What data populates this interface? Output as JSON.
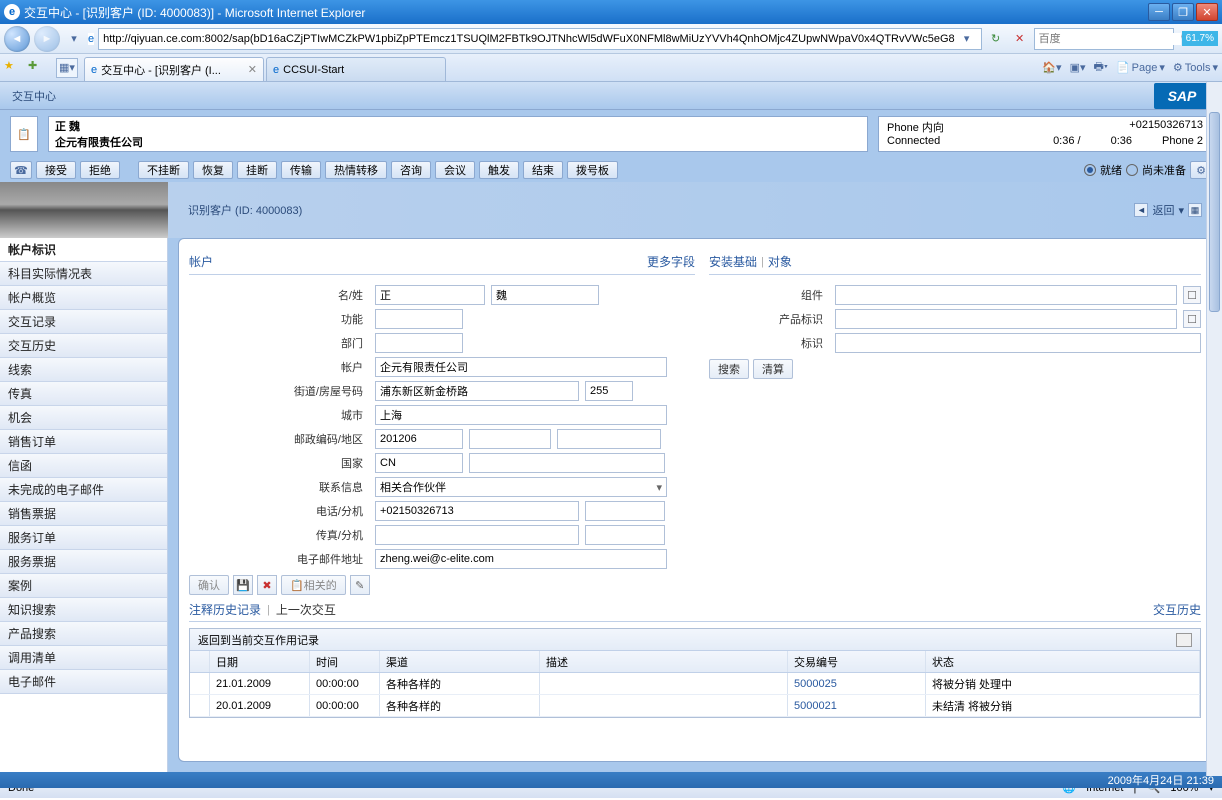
{
  "window": {
    "title": "交互中心 - [识别客户 (ID: 4000083)] - Microsoft Internet Explorer"
  },
  "nav": {
    "url": "http://qiyuan.ce.com:8002/sap(bD16aCZjPTIwMCZkPW1pbiZpPTEmcz1TSUQlM2FBTk9OJTNhcWl5dWFuX0NFMl8wMiUzYVVh4QnhOMjc4ZUpwNWpaV0x4QTRvVWc5eG8",
    "search_placeholder": "百度",
    "zoom": "61.7%"
  },
  "tabs": [
    {
      "label": "交互中心 - [识别客户 (I...",
      "active": true
    },
    {
      "label": "CCSUI-Start",
      "active": false
    }
  ],
  "toolbar_menu": {
    "page": "Page",
    "tools": "Tools"
  },
  "sap": {
    "header": "交互中心",
    "contact_name": "正  魏",
    "contact_company": "企元有限责任公司",
    "phone_block": {
      "direction_label": "Phone 内向",
      "number": "+02150326713",
      "status": "Connected",
      "time1": "0:36 /",
      "time2": "0:36",
      "phone2": "Phone 2"
    },
    "actions": {
      "accept": "接受",
      "reject": "拒绝",
      "hold": "不挂断",
      "resume": "恢复",
      "hangup": "挂断",
      "transfer": "传输",
      "warm": "热情转移",
      "consult": "咨询",
      "conference": "会议",
      "trigger": "触发",
      "end": "结束",
      "dialpad": "拨号板",
      "ready": "就绪",
      "notready": "尚未准备"
    },
    "title": "识别客户  (ID: 4000083)",
    "back": "返回",
    "sidebar": [
      "帐户标识",
      "科目实际情况表",
      "帐户概览",
      "交互记录",
      "交互历史",
      "线索",
      "传真",
      "机会",
      "销售订单",
      "信函",
      "未完成的电子邮件",
      "销售票据",
      "服务订单",
      "服务票据",
      "案例",
      "知识搜索",
      "产品搜索",
      "调用清单",
      "电子邮件"
    ],
    "account_panel": {
      "title": "帐户",
      "more": "更多字段",
      "labels": {
        "name": "名/姓",
        "function": "功能",
        "dept": "部门",
        "account": "帐户",
        "street": "街道/房屋号码",
        "city": "城市",
        "postal": "邮政编码/地区",
        "country": "国家",
        "contact": "联系信息",
        "phone": "电话/分机",
        "fax": "传真/分机",
        "email": "电子邮件地址"
      },
      "values": {
        "first": "正",
        "last": "魏",
        "account": "企元有限责任公司",
        "street": "浦东新区新金桥路",
        "house": "255",
        "city": "上海",
        "postal": "201206",
        "country": "CN",
        "contact": "相关合作伙伴",
        "phone": "+02150326713",
        "email": "zheng.wei@c-elite.com"
      },
      "confirm": "确认",
      "related": "相关的"
    },
    "install_panel": {
      "title": "安装基础",
      "alt": "对象",
      "component": "组件",
      "product": "产品标识",
      "id": "标识",
      "search": "搜索",
      "clear": "清算"
    },
    "history": {
      "tab1": "注释历史记录",
      "tab2": "上一次交互",
      "link": "交互历史",
      "subtitle": "返回到当前交互作用记录",
      "cols": {
        "date": "日期",
        "time": "时间",
        "channel": "渠道",
        "desc": "描述",
        "txn": "交易编号",
        "status": "状态"
      },
      "rows": [
        {
          "date": "21.01.2009",
          "time": "00:00:00",
          "channel": "各种各样的",
          "desc": "",
          "txn": "5000025",
          "status": "将被分销  处理中"
        },
        {
          "date": "20.01.2009",
          "time": "00:00:00",
          "channel": "各种各样的",
          "desc": "",
          "txn": "5000021",
          "status": "未结清  将被分销"
        }
      ]
    }
  },
  "datetime": "2009年4月24日  21:39",
  "status": {
    "done": "Done",
    "zone": "Internet",
    "zoom": "100%"
  }
}
